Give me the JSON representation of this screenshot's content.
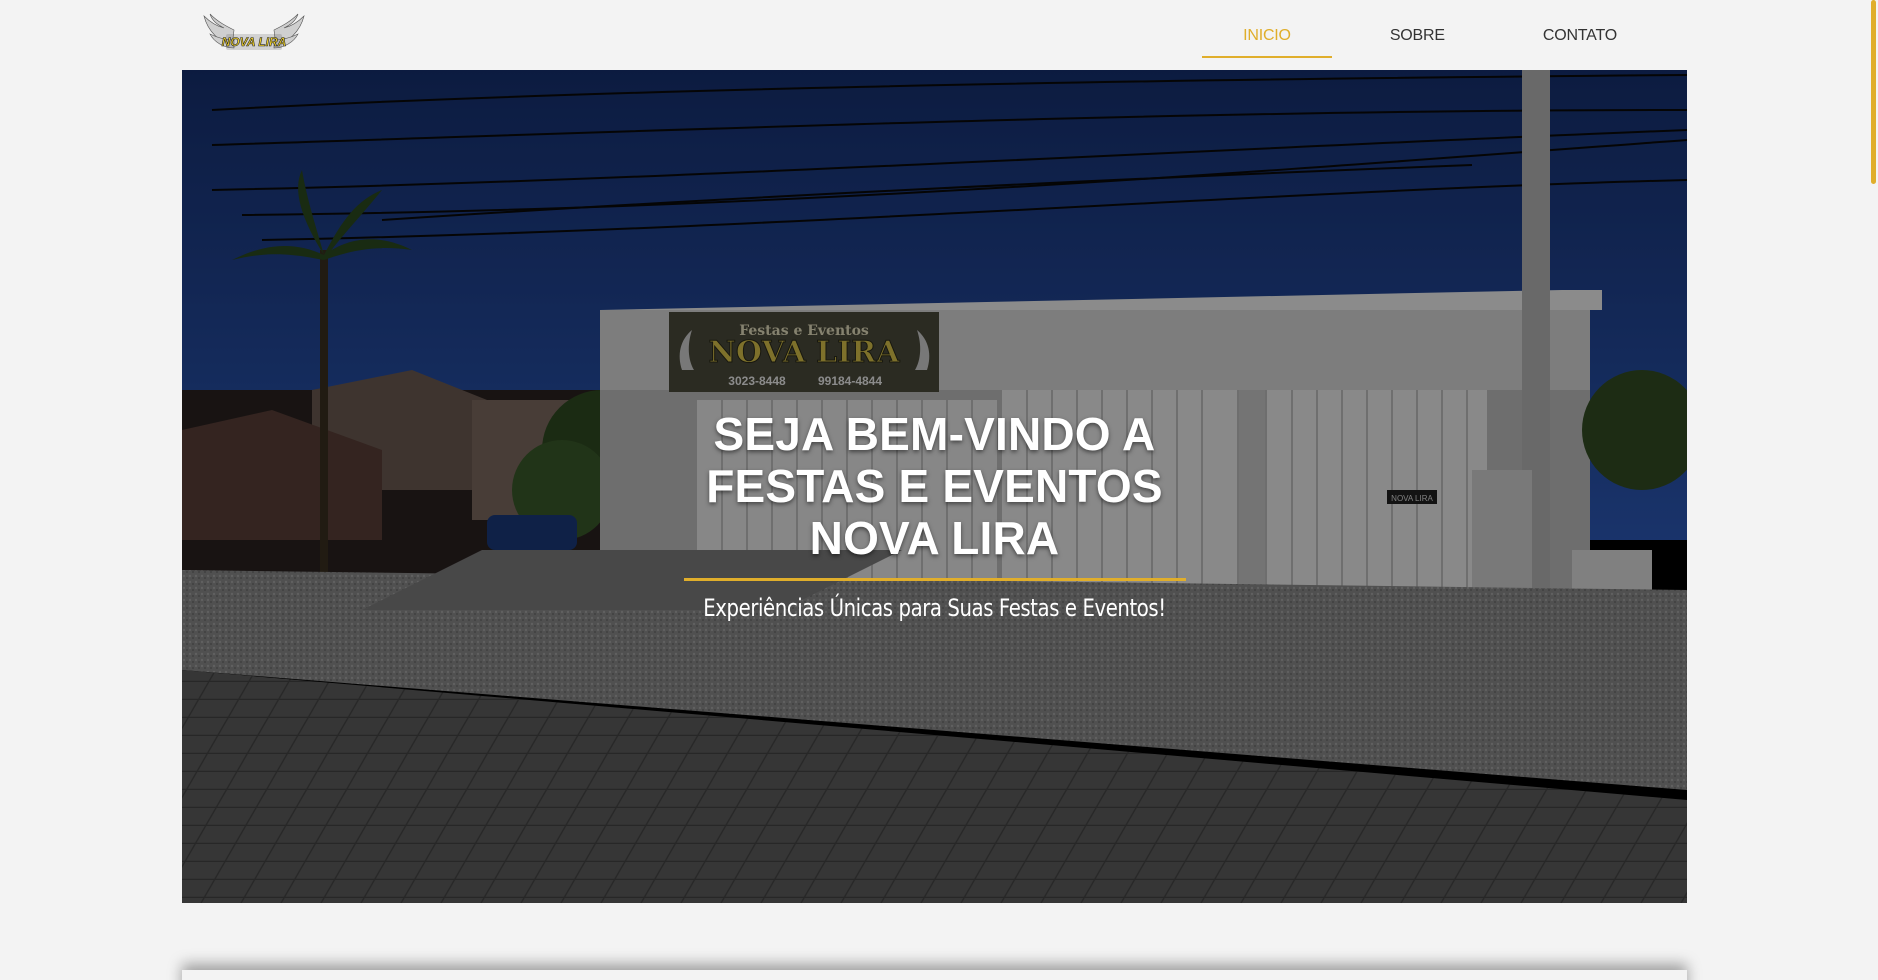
{
  "brand": {
    "logo_text": "NOVA LIRA",
    "accent_color": "#e0ae2b"
  },
  "nav": {
    "items": [
      {
        "label": "INICIO",
        "active": true
      },
      {
        "label": "SOBRE",
        "active": false
      },
      {
        "label": "CONTATO",
        "active": false
      }
    ]
  },
  "hero": {
    "title": "SEJA BEM-VINDO A FESTAS E EVENTOS NOVA LIRA",
    "subtitle": "Experiências Únicas para Suas Festas e Eventos!",
    "storefront_sign": {
      "line1": "Festas e Eventos",
      "line2": "NOVA LIRA",
      "phone1": "3023-8448",
      "phone2": "99184-4844"
    },
    "door_sign": "NOVA LIRA"
  }
}
